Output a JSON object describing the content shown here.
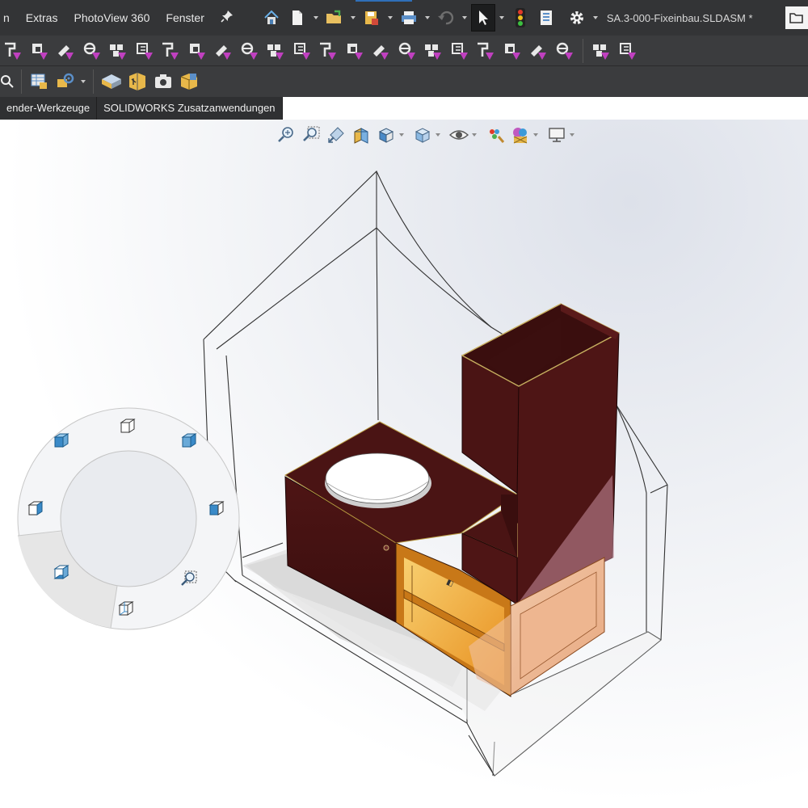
{
  "menu": {
    "items": [
      "n",
      "Extras",
      "PhotoView 360",
      "Fenster"
    ],
    "pin_icon": "pin-icon"
  },
  "quick_access": {
    "icons": [
      "home-icon",
      "new-document-icon",
      "open-icon",
      "save-icon",
      "print-icon",
      "undo-icon",
      "select-icon",
      "rebuild-traffic-light-icon",
      "file-properties-icon",
      "options-gear-icon"
    ]
  },
  "document": {
    "title": "SA.3-000-Fixeinbau.SLDASM *",
    "open_icon": "folder-open-icon"
  },
  "tabs": {
    "items": [
      "ender-Werkzeuge",
      "SOLIDWORKS Zusatzanwendungen"
    ]
  },
  "heads_up_toolbar": {
    "icons": [
      "zoom-to-fit-icon",
      "zoom-to-area-icon",
      "previous-view-icon",
      "section-view-icon",
      "view-orientation-icon",
      "display-style-icon",
      "hide-show-items-icon",
      "edit-appearance-icon",
      "apply-scene-icon",
      "view-settings-icon"
    ]
  },
  "colors": {
    "titlebar": "#333436",
    "toolbar": "#3b3c3e",
    "cabinet": "#4a1414",
    "accent_orange": "#f0a030",
    "toolbar_magenta": "#c040c0"
  }
}
